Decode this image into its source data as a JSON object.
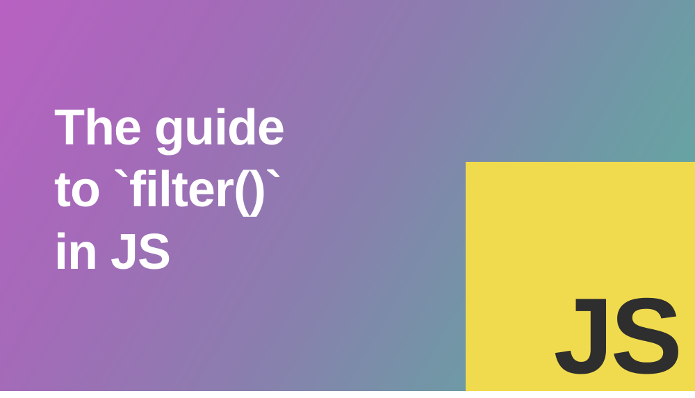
{
  "banner": {
    "title_line1": "The guide",
    "title_line2": "to `filter()`",
    "title_line3": "in JS",
    "logo_text": "JS"
  },
  "colors": {
    "gradient_start": "#b861c2",
    "gradient_end": "#5fb1a0",
    "js_yellow": "#f0db4f",
    "js_text": "#2e2e2e",
    "title_color": "#ffffff"
  }
}
